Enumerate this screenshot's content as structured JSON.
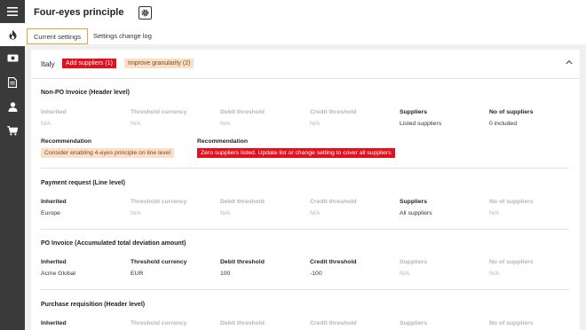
{
  "page": {
    "title": "Four-eyes principle"
  },
  "tabs": [
    {
      "label": "Current settings"
    },
    {
      "label": "Settings change log"
    }
  ],
  "sidebar": {
    "items": [
      {
        "icon": "menu-icon"
      },
      {
        "icon": "flame-icon",
        "active": true
      },
      {
        "icon": "money-icon"
      },
      {
        "icon": "document-icon"
      },
      {
        "icon": "user-icon"
      },
      {
        "icon": "cart-icon"
      }
    ]
  },
  "card": {
    "country": "Italy",
    "badges": {
      "add_suppliers": "Add suppliers (1)",
      "improve_granularity": "Improve granularity (2)"
    },
    "columns": [
      "Inherited",
      "Threshold currency",
      "Debit threshold",
      "Credit threshold",
      "Suppliers",
      "No of suppliers"
    ],
    "sections": [
      {
        "title": "Non-PO Invoice (Header level)",
        "values": [
          "N/A",
          "N/A",
          "N/A",
          "N/A",
          "Listed suppliers",
          "0 included"
        ],
        "recommendations": [
          {
            "label": "Recommendation",
            "text": "Consider enabling 4-eyes principle on line level"
          },
          {
            "label": "Recommendation",
            "text": "Zero suppliers listed. Update list or change setting to cover all suppliers"
          }
        ]
      },
      {
        "title": "Payment request (Line level)",
        "values": [
          "Europe",
          "N/A",
          "N/A",
          "N/A",
          "All suppliers",
          "N/A"
        ]
      },
      {
        "title": "PO Invoice (Accumulated total deviation amount)",
        "values": [
          "Acme Global",
          "EUR",
          "100",
          "-100",
          "N/A",
          "N/A"
        ]
      },
      {
        "title": "Purchase requisition (Header level)"
      }
    ]
  },
  "colors": {
    "accent_tab_border": "#e8a33d",
    "alert_red": "#e3101e",
    "warning_amber_bg": "#fbdfc7",
    "sidebar_bg": "#3a3a3a"
  }
}
